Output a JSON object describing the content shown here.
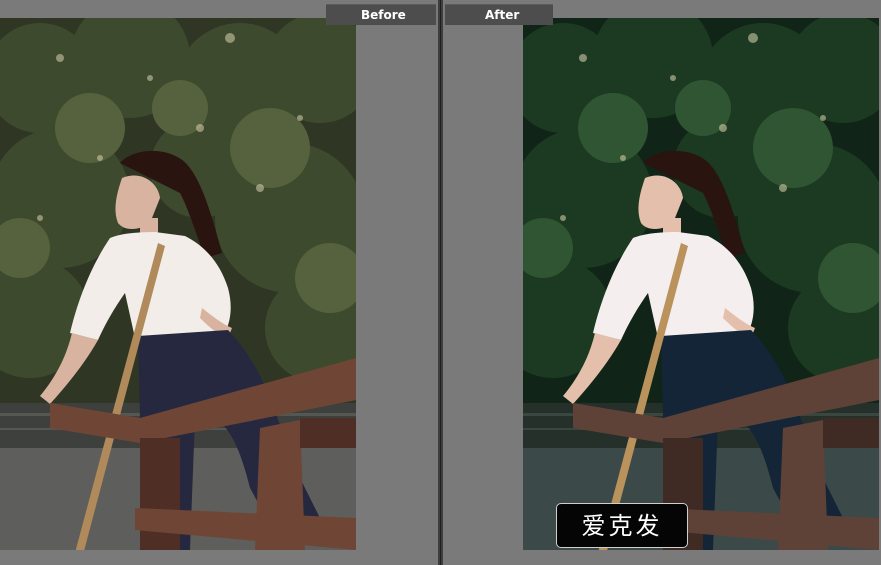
{
  "views": {
    "before": {
      "label": "Before"
    },
    "after": {
      "label": "After"
    }
  },
  "watermark": {
    "text": "爱克发"
  },
  "colors": {
    "background": "#7a7a7a",
    "label_bg": "#4d4d4d",
    "label_text": "#ffffff",
    "divider": "#3e3e3e"
  }
}
